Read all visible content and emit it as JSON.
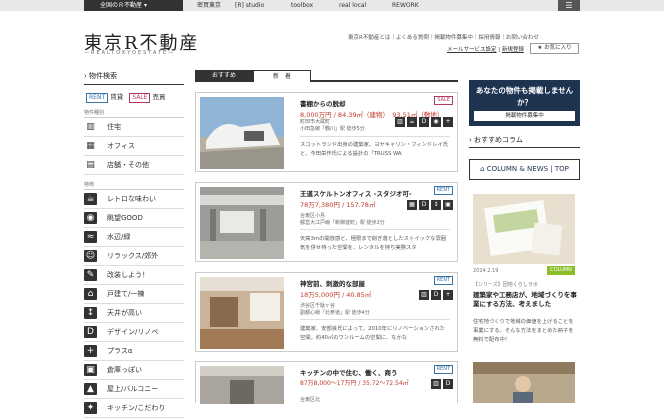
{
  "topbar": {
    "dropdown": "全国のＲ不動産",
    "nav": [
      "密買東京",
      "[R] studio",
      "toolbox",
      "real local",
      "REWORK"
    ]
  },
  "header": {
    "logo": "東京R不動産",
    "logo_sub": "—REALTOKYOESTATE—",
    "links": "東京R不動産とは｜よくある質問｜掲載物件募集中｜採用情報｜お問い合わせ",
    "service": "メールサービス設定",
    "register": "新規登録",
    "favorite": "★ お気に入り"
  },
  "sidebar": {
    "title": "物件検索",
    "rent_tag": "RENT",
    "rent_label": "賃貸",
    "sale_tag": "SALE",
    "sale_label": "売買",
    "type_head": "物件種別",
    "types": [
      {
        "icon": "building-icon",
        "label": "住宅"
      },
      {
        "icon": "office-icon",
        "label": "オフィス"
      },
      {
        "icon": "shop-icon",
        "label": "店舗・その他"
      }
    ],
    "feature_head": "特徴",
    "features": [
      {
        "icon": "cup-icon",
        "label": "レトロな味わい"
      },
      {
        "icon": "eye-icon",
        "label": "眺望GOOD"
      },
      {
        "icon": "wave-icon",
        "label": "水辺/緑"
      },
      {
        "icon": "relax-icon",
        "label": "リラックス/郊外"
      },
      {
        "icon": "megaphone-icon",
        "label": "改装しよう！"
      },
      {
        "icon": "house-icon",
        "label": "戸建て/一棟"
      },
      {
        "icon": "ceiling-icon",
        "label": "天井が高い"
      },
      {
        "icon": "design-icon",
        "label": "デザイン/リノベ"
      },
      {
        "icon": "plus-icon",
        "label": "プラスα"
      },
      {
        "icon": "warehouse-icon",
        "label": "倉庫っぽい"
      },
      {
        "icon": "rooftop-icon",
        "label": "屋上/バルコニー"
      },
      {
        "icon": "more-icon",
        "label": "キッチン/こだわり"
      }
    ]
  },
  "tabs": {
    "recommended": "おすすめ",
    "new": "新　着"
  },
  "listings": [
    {
      "title": "書棚からの脱却",
      "badge": "SALE",
      "price": "8,000万円 / 84.39㎡（建物）　93.51㎡（敷地）",
      "address": "町田市大蔵町",
      "station": "小田急線「鶴川」駅 徒歩5分",
      "desc": "スコットランド出身の建築家、ヨヤキャリン・フィンドレイ氏と、今田栄作氏による設計の「TRUSS WA"
    },
    {
      "title": "王道スケルトンオフィス -スタジオ可-",
      "badge": "RENT",
      "price": "78万7,380円 / 157.78㎡",
      "address": "台東区小島",
      "station": "都営大江戸線「新御徒町」駅 徒歩2分",
      "desc": "天高3mの開放感と、極限まで削ぎ落としたストイックな雰囲気を併せ持った空間を、レンタルを持ち実務スタ"
    },
    {
      "title": "神宮前、刺激的な部屋",
      "badge": "RENT",
      "price": "18万5,000円 / 40.85㎡",
      "address": "渋谷区千駄ヶ谷",
      "station": "副都心線「北参道」駅 徒歩4分",
      "desc": "建築家、安部良氏によって、2010年にリノベーションされた空間。約40㎡のワンルームの空間に、なかな"
    },
    {
      "title": "キッチンの中で住む、働く、商う",
      "badge": "RENT",
      "price": "87万8,000〜17万円 / 35.72〜72.54㎡",
      "address": "台東区北",
      "station": "",
      "desc": ""
    }
  ],
  "right": {
    "cta_title": "あなたの物件も掲載しませんか？",
    "cta_button": "掲載物件募集中",
    "column_head": "おすすめコラム",
    "column_button": "COLUMN & NEWS | TOP",
    "article_date": "2024.2.19",
    "article_badge": "COLUMN",
    "article_tag": "【シリーズ】団地くらしラボ",
    "article_title": "建築家や工務店が、地域づくりを事業にする方法、考えました",
    "article_desc": "住宅地づくりで地域の価値を上げることを事業にする。そんな方法をまとめた冊子を無料で配布中！"
  },
  "colors": {
    "navy": "#1e3350",
    "rent": "#3a74a8",
    "sale": "#b33a66",
    "price": "#c0392b",
    "green": "#8bbf2a"
  }
}
